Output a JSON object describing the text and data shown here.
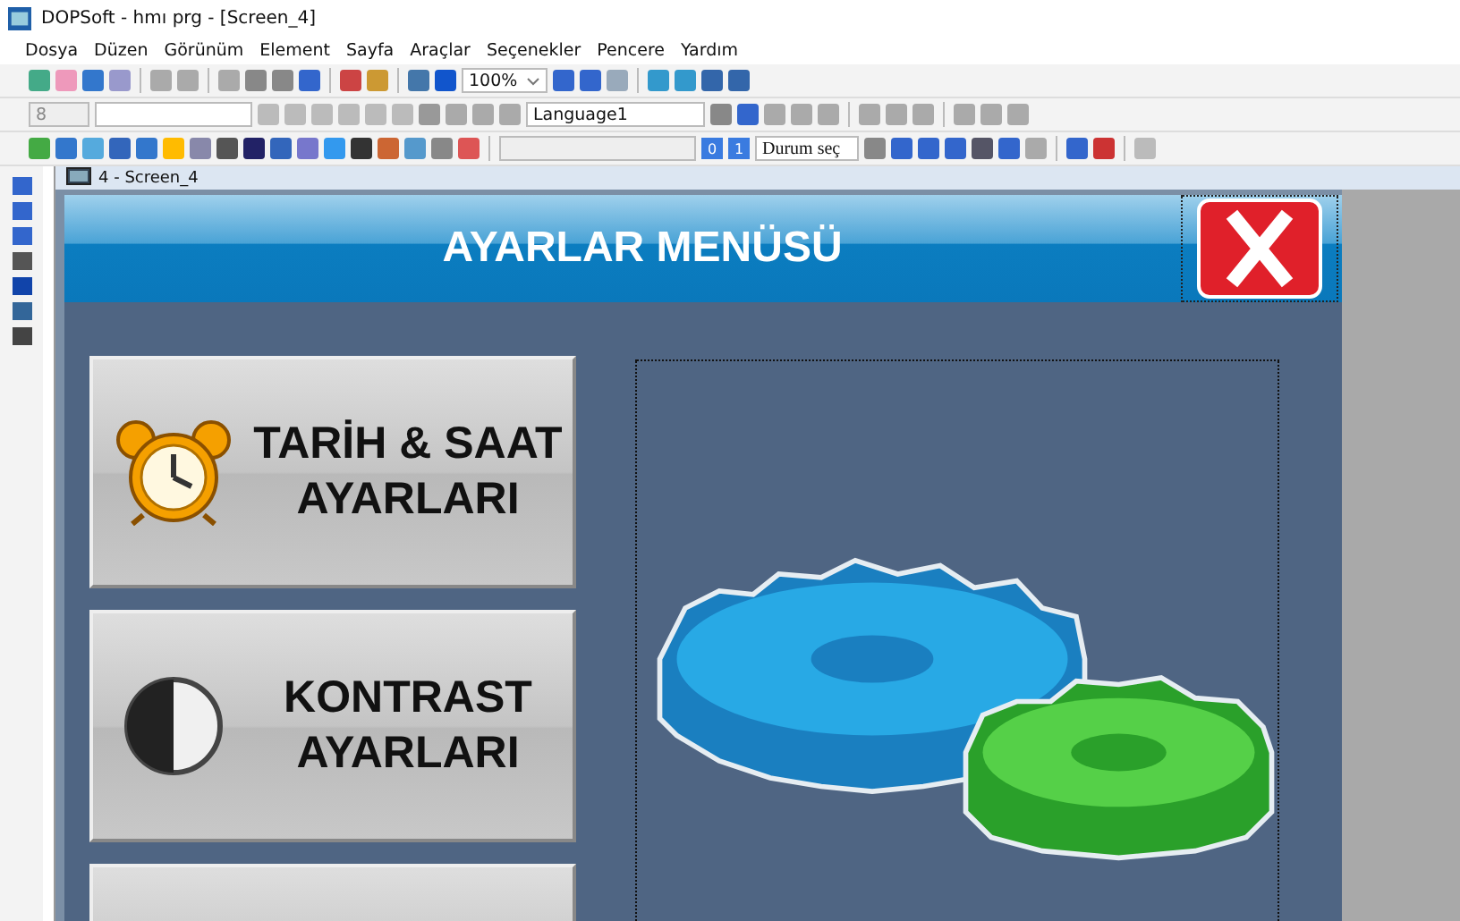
{
  "window": {
    "title": "DOPSoft - hmı prg - [Screen_4]"
  },
  "menu": [
    "Dosya",
    "Düzen",
    "Görünüm",
    "Element",
    "Sayfa",
    "Araçlar",
    "Seçenekler",
    "Pencere",
    "Yardım"
  ],
  "toolbar": {
    "zoom": "100%",
    "font_size": "8",
    "language": "Language1",
    "state_buttons": [
      "0",
      "1"
    ],
    "state_select": "Durum seç"
  },
  "document": {
    "title": "4 - Screen_4"
  },
  "screen": {
    "header": "AYARLAR MENÜSÜ",
    "buttons": [
      {
        "kind": "clock",
        "lines": [
          "TARİH & SAAT",
          "AYARLARI"
        ]
      },
      {
        "kind": "contrast",
        "lines": [
          "KONTRAST",
          "AYARLARI"
        ]
      },
      {
        "kind": "blank"
      }
    ]
  }
}
